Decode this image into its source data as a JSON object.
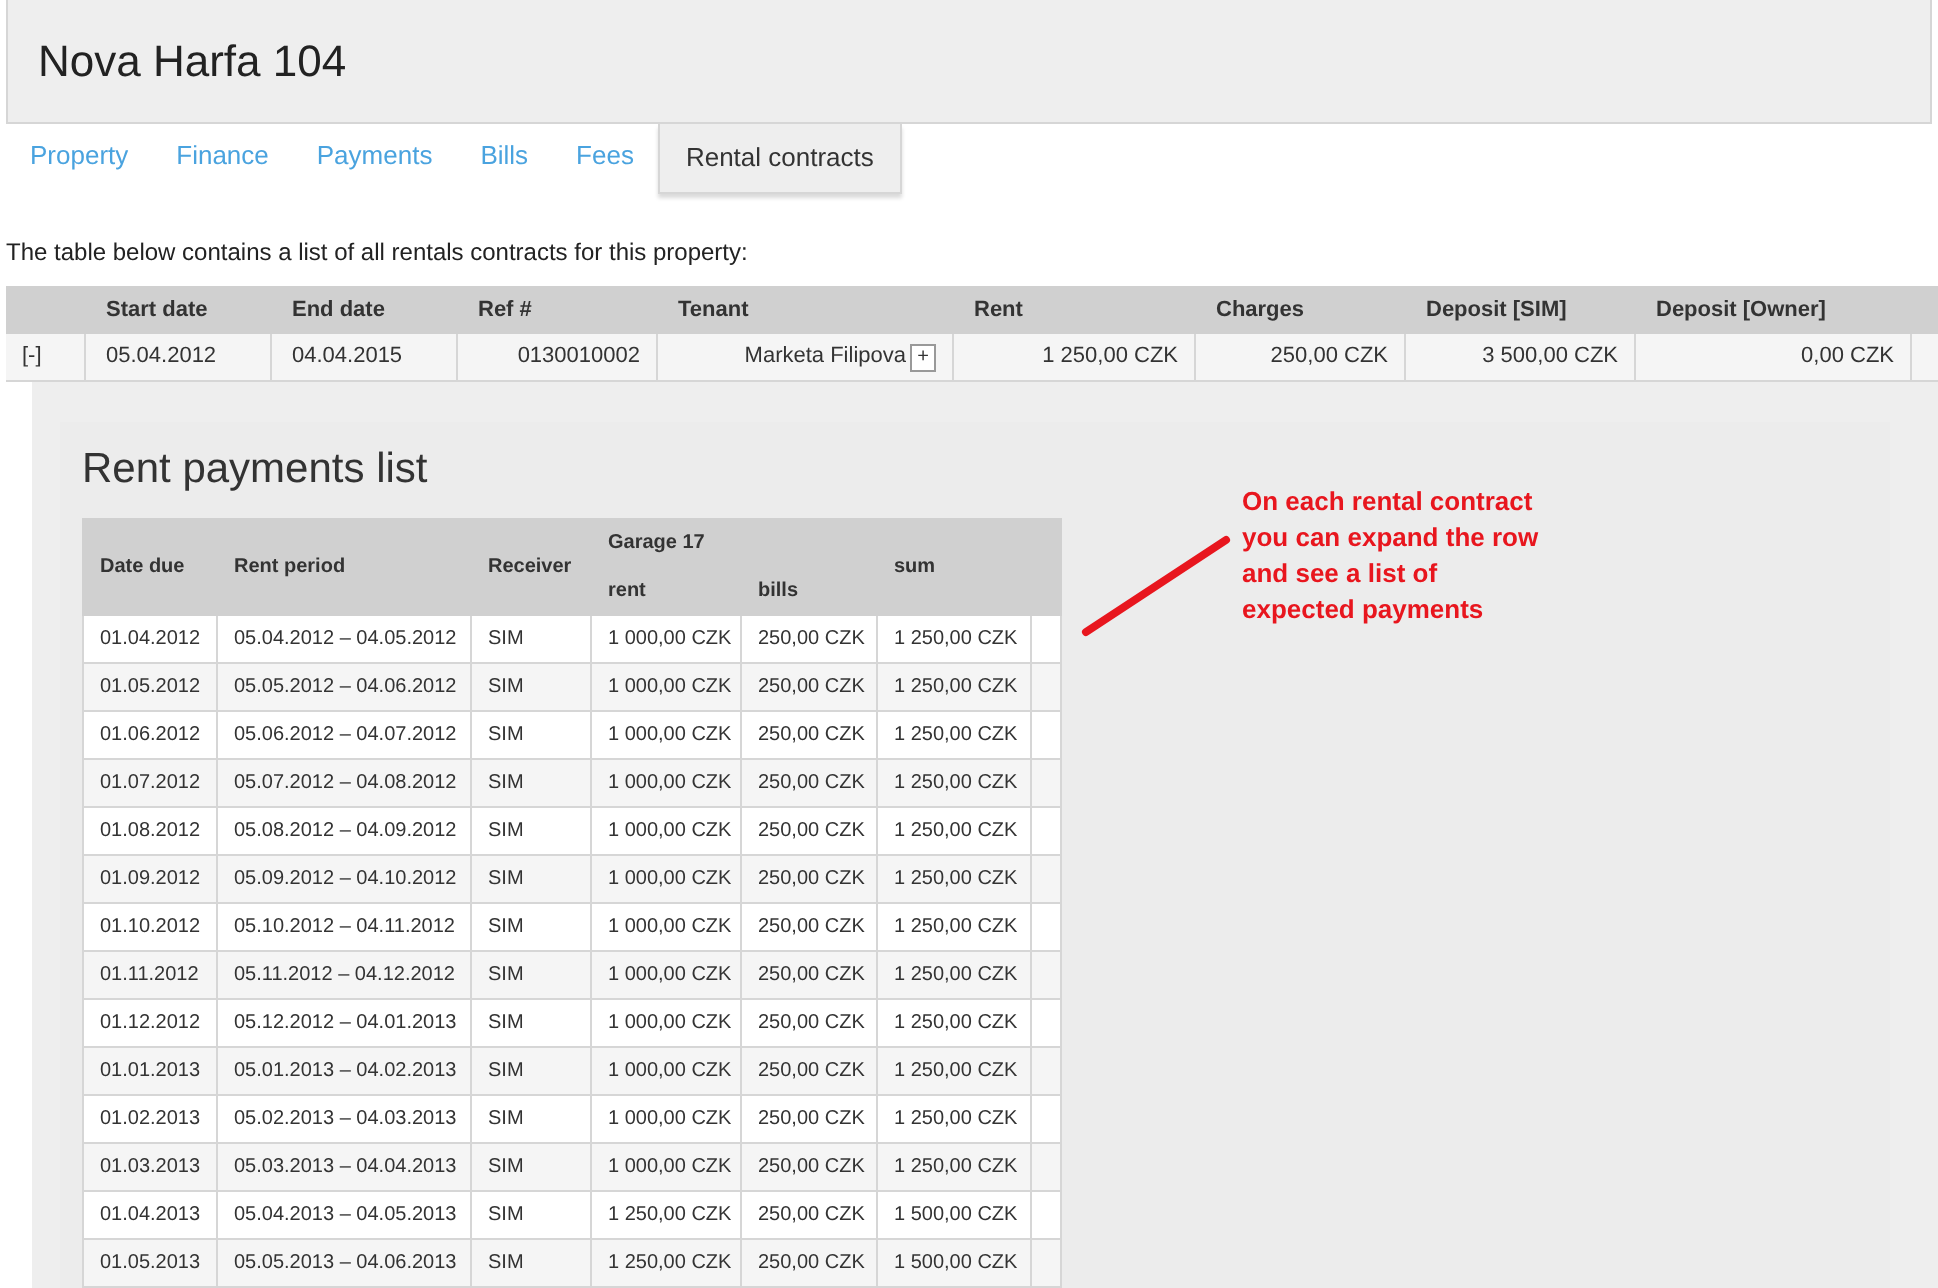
{
  "page_title": "Nova Harfa 104",
  "tabs": [
    {
      "label": "Property",
      "selected": false
    },
    {
      "label": "Finance",
      "selected": false
    },
    {
      "label": "Payments",
      "selected": false
    },
    {
      "label": "Bills",
      "selected": false
    },
    {
      "label": "Fees",
      "selected": false
    },
    {
      "label": "Rental contracts",
      "selected": true
    }
  ],
  "intro": "The table below contains a list of all rentals contracts for this property:",
  "contracts_table": {
    "columns": [
      "Start date",
      "End date",
      "Ref #",
      "Tenant",
      "Rent",
      "Charges",
      "Deposit [SIM]",
      "Deposit [Owner]"
    ],
    "rows": [
      {
        "toggle": "[-]",
        "start_date": "05.04.2012",
        "end_date": "04.04.2015",
        "ref": "0130010002",
        "tenant": "Marketa Filipova",
        "tenant_button": "+",
        "rent": "1 250,00 CZK",
        "charges": "250,00 CZK",
        "deposit_sim": "3 500,00 CZK",
        "deposit_owner": "0,00 CZK"
      }
    ]
  },
  "payments": {
    "title": "Rent payments list",
    "columns": {
      "date_due": "Date due",
      "rent_period": "Rent period",
      "receiver": "Receiver",
      "group": "Garage 17",
      "rent": "rent",
      "bills": "bills",
      "sum": "sum"
    },
    "rows": [
      {
        "date_due": "01.04.2012",
        "rent_period": "05.04.2012 – 04.05.2012",
        "receiver": "SIM",
        "rent": "1 000,00 CZK",
        "bills": "250,00 CZK",
        "sum": "1 250,00 CZK"
      },
      {
        "date_due": "01.05.2012",
        "rent_period": "05.05.2012 – 04.06.2012",
        "receiver": "SIM",
        "rent": "1 000,00 CZK",
        "bills": "250,00 CZK",
        "sum": "1 250,00 CZK"
      },
      {
        "date_due": "01.06.2012",
        "rent_period": "05.06.2012 – 04.07.2012",
        "receiver": "SIM",
        "rent": "1 000,00 CZK",
        "bills": "250,00 CZK",
        "sum": "1 250,00 CZK"
      },
      {
        "date_due": "01.07.2012",
        "rent_period": "05.07.2012 – 04.08.2012",
        "receiver": "SIM",
        "rent": "1 000,00 CZK",
        "bills": "250,00 CZK",
        "sum": "1 250,00 CZK"
      },
      {
        "date_due": "01.08.2012",
        "rent_period": "05.08.2012 – 04.09.2012",
        "receiver": "SIM",
        "rent": "1 000,00 CZK",
        "bills": "250,00 CZK",
        "sum": "1 250,00 CZK"
      },
      {
        "date_due": "01.09.2012",
        "rent_period": "05.09.2012 – 04.10.2012",
        "receiver": "SIM",
        "rent": "1 000,00 CZK",
        "bills": "250,00 CZK",
        "sum": "1 250,00 CZK"
      },
      {
        "date_due": "01.10.2012",
        "rent_period": "05.10.2012 – 04.11.2012",
        "receiver": "SIM",
        "rent": "1 000,00 CZK",
        "bills": "250,00 CZK",
        "sum": "1 250,00 CZK"
      },
      {
        "date_due": "01.11.2012",
        "rent_period": "05.11.2012 – 04.12.2012",
        "receiver": "SIM",
        "rent": "1 000,00 CZK",
        "bills": "250,00 CZK",
        "sum": "1 250,00 CZK"
      },
      {
        "date_due": "01.12.2012",
        "rent_period": "05.12.2012 – 04.01.2013",
        "receiver": "SIM",
        "rent": "1 000,00 CZK",
        "bills": "250,00 CZK",
        "sum": "1 250,00 CZK"
      },
      {
        "date_due": "01.01.2013",
        "rent_period": "05.01.2013 – 04.02.2013",
        "receiver": "SIM",
        "rent": "1 000,00 CZK",
        "bills": "250,00 CZK",
        "sum": "1 250,00 CZK"
      },
      {
        "date_due": "01.02.2013",
        "rent_period": "05.02.2013 – 04.03.2013",
        "receiver": "SIM",
        "rent": "1 000,00 CZK",
        "bills": "250,00 CZK",
        "sum": "1 250,00 CZK"
      },
      {
        "date_due": "01.03.2013",
        "rent_period": "05.03.2013 – 04.04.2013",
        "receiver": "SIM",
        "rent": "1 000,00 CZK",
        "bills": "250,00 CZK",
        "sum": "1 250,00 CZK"
      },
      {
        "date_due": "01.04.2013",
        "rent_period": "05.04.2013 – 04.05.2013",
        "receiver": "SIM",
        "rent": "1 250,00 CZK",
        "bills": "250,00 CZK",
        "sum": "1 500,00 CZK"
      },
      {
        "date_due": "01.05.2013",
        "rent_period": "05.05.2013 – 04.06.2013",
        "receiver": "SIM",
        "rent": "1 250,00 CZK",
        "bills": "250,00 CZK",
        "sum": "1 500,00 CZK"
      }
    ]
  },
  "annotation": "On each rental contract you can expand the row and see a list of expected payments"
}
